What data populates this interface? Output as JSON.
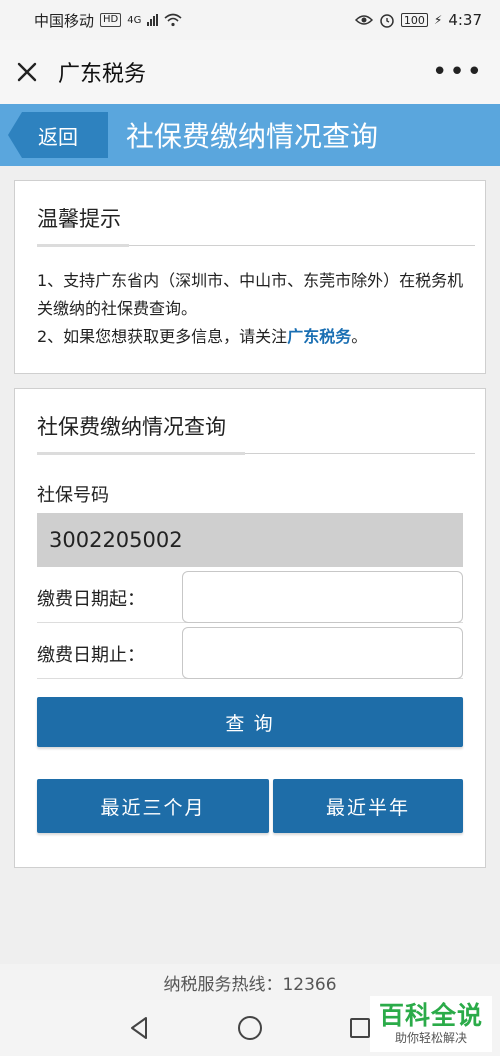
{
  "status_bar": {
    "carrier": "中国移动",
    "hd_badge": "HD",
    "network": "4G",
    "battery": "100",
    "time": "4:37"
  },
  "wechat_bar": {
    "title": "广东税务",
    "close_icon": "close-icon",
    "more_icon": "more-icon"
  },
  "header": {
    "back_label": "返回",
    "title": "社保费缴纳情况查询"
  },
  "tips": {
    "heading": "温馨提示",
    "line1": "1、支持广东省内（深圳市、中山市、东莞市除外）在税务机关缴纳的社保费查询。",
    "line2_prefix": "2、如果您想获取更多信息，请关注",
    "line2_link": "广东税务",
    "line2_suffix": "。"
  },
  "query": {
    "heading": "社保费缴纳情况查询",
    "ssn_label": "社保号码",
    "ssn_value": "3002205002",
    "start_label": "缴费日期起：",
    "end_label": "缴费日期止：",
    "query_button": "查 询",
    "three_months_button": "最近三个月",
    "half_year_button": "最近半年"
  },
  "footer": {
    "hotline": "纳税服务热线：12366"
  },
  "watermark": {
    "title": "百科全说",
    "subtitle": "助你轻松解决"
  },
  "colors": {
    "header_bg": "#5aa6dd",
    "back_bg": "#2e82bf",
    "button_bg": "#1e6da8",
    "link": "#1a6fb3",
    "watermark": "#2bab49"
  }
}
